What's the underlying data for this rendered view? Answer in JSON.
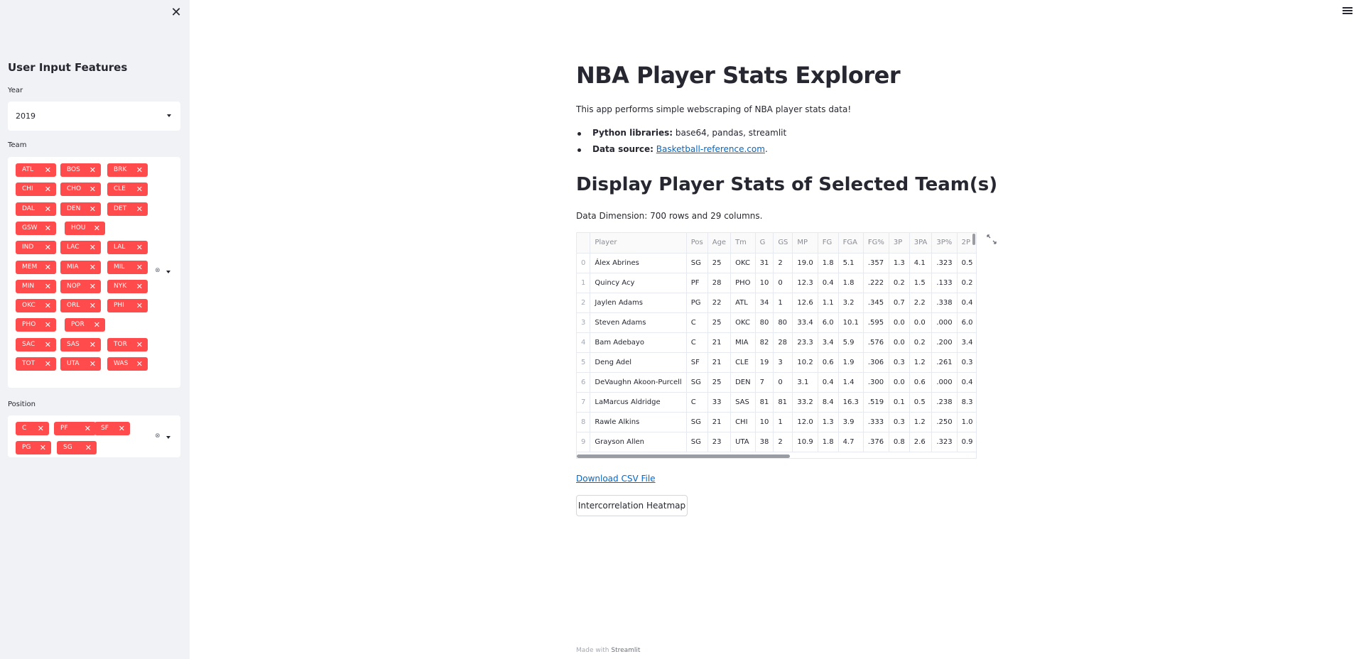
{
  "sidebar": {
    "close_icon": "close-icon",
    "title": "User Input Features",
    "year": {
      "label": "Year",
      "value": "2019"
    },
    "team": {
      "label": "Team",
      "tags": [
        "ATL",
        "BOS",
        "BRK",
        "CHI",
        "CHO",
        "CLE",
        "DAL",
        "DEN",
        "DET",
        "GSW",
        "HOU",
        "IND",
        "LAC",
        "LAL",
        "MEM",
        "MIA",
        "MIL",
        "MIN",
        "NOP",
        "NYK",
        "OKC",
        "ORL",
        "PHI",
        "PHO",
        "POR",
        "SAC",
        "SAS",
        "TOR",
        "TOT",
        "UTA",
        "WAS"
      ]
    },
    "position": {
      "label": "Position",
      "tags": [
        "C",
        "PF",
        "SF",
        "PG",
        "SG"
      ]
    }
  },
  "main": {
    "menu_icon": "hamburger-menu-icon",
    "title": "NBA Player Stats Explorer",
    "intro": "This app performs simple webscraping of NBA player stats data!",
    "bullets": [
      {
        "bold": "Python libraries:",
        "text": " base64, pandas, streamlit"
      },
      {
        "bold": "Data source:",
        "link": "Basketball-reference.com",
        "after": "."
      }
    ],
    "section_title": "Display Player Stats of Selected Team(s)",
    "dimension_text": "Data Dimension: 700 rows and 29 columns.",
    "table": {
      "columns": [
        "",
        "Player",
        "Pos",
        "Age",
        "Tm",
        "G",
        "GS",
        "MP",
        "FG",
        "FGA",
        "FG%",
        "3P",
        "3PA",
        "3P%",
        "2P"
      ],
      "rows": [
        [
          "0",
          "Álex Abrines",
          "SG",
          "25",
          "OKC",
          "31",
          "2",
          "19.0",
          "1.8",
          "5.1",
          ".357",
          "1.3",
          "4.1",
          ".323",
          "0.5"
        ],
        [
          "1",
          "Quincy Acy",
          "PF",
          "28",
          "PHO",
          "10",
          "0",
          "12.3",
          "0.4",
          "1.8",
          ".222",
          "0.2",
          "1.5",
          ".133",
          "0.2"
        ],
        [
          "2",
          "Jaylen Adams",
          "PG",
          "22",
          "ATL",
          "34",
          "1",
          "12.6",
          "1.1",
          "3.2",
          ".345",
          "0.7",
          "2.2",
          ".338",
          "0.4"
        ],
        [
          "3",
          "Steven Adams",
          "C",
          "25",
          "OKC",
          "80",
          "80",
          "33.4",
          "6.0",
          "10.1",
          ".595",
          "0.0",
          "0.0",
          ".000",
          "6.0"
        ],
        [
          "4",
          "Bam Adebayo",
          "C",
          "21",
          "MIA",
          "82",
          "28",
          "23.3",
          "3.4",
          "5.9",
          ".576",
          "0.0",
          "0.2",
          ".200",
          "3.4"
        ],
        [
          "5",
          "Deng Adel",
          "SF",
          "21",
          "CLE",
          "19",
          "3",
          "10.2",
          "0.6",
          "1.9",
          ".306",
          "0.3",
          "1.2",
          ".261",
          "0.3"
        ],
        [
          "6",
          "DeVaughn Akoon-Purcell",
          "SG",
          "25",
          "DEN",
          "7",
          "0",
          "3.1",
          "0.4",
          "1.4",
          ".300",
          "0.0",
          "0.6",
          ".000",
          "0.4"
        ],
        [
          "7",
          "LaMarcus Aldridge",
          "C",
          "33",
          "SAS",
          "81",
          "81",
          "33.2",
          "8.4",
          "16.3",
          ".519",
          "0.1",
          "0.5",
          ".238",
          "8.3"
        ],
        [
          "8",
          "Rawle Alkins",
          "SG",
          "21",
          "CHI",
          "10",
          "1",
          "12.0",
          "1.3",
          "3.9",
          ".333",
          "0.3",
          "1.2",
          ".250",
          "1.0"
        ],
        [
          "9",
          "Grayson Allen",
          "SG",
          "23",
          "UTA",
          "38",
          "2",
          "10.9",
          "1.8",
          "4.7",
          ".376",
          "0.8",
          "2.6",
          ".323",
          "0.9"
        ]
      ]
    },
    "download_link": "Download CSV File",
    "heatmap_button": "Intercorrelation Heatmap",
    "footer_prefix": "Made with ",
    "footer_brand": "Streamlit"
  }
}
